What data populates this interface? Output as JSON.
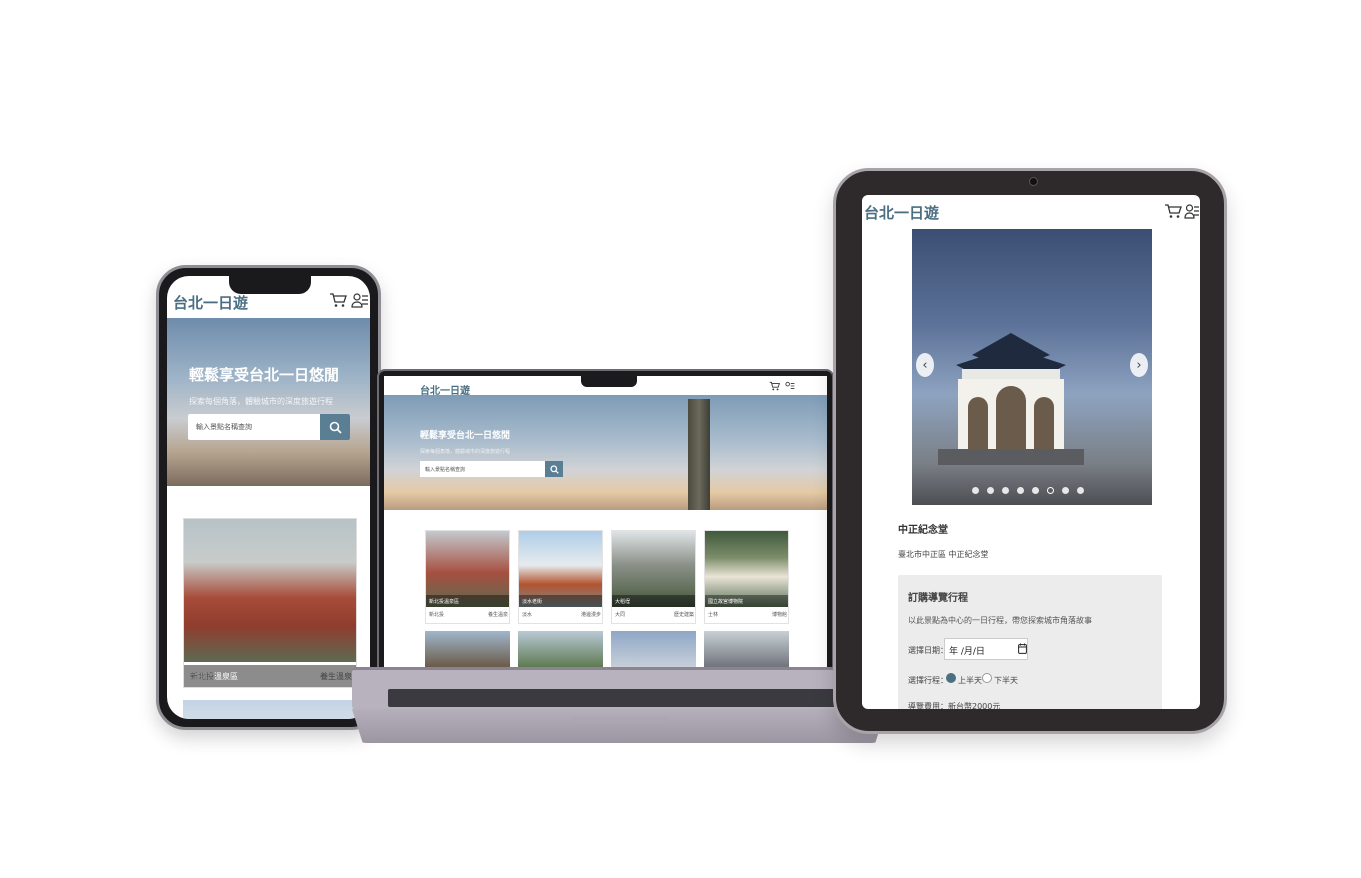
{
  "brand": {
    "name": "台北一日遊",
    "accent": "#4a6f82",
    "button": "#5a7f95"
  },
  "phone": {
    "hero_title": "輕鬆享受台北一日悠閒",
    "hero_subtitle": "探索每個角落，體驗城市的深度旅遊行程",
    "search_placeholder": "輸入景點名稱查詢",
    "card": {
      "caption": "新北投溫泉區",
      "area": "新北投",
      "tag": "養生溫泉"
    }
  },
  "laptop": {
    "hero_title": "輕鬆享受台北一日悠閒",
    "hero_subtitle": "探索每個角落，體驗城市的深度旅遊行程",
    "search_placeholder": "輸入景點名稱查詢",
    "cards": [
      {
        "caption": "新北投溫泉區",
        "area": "新北投",
        "tag": "養生溫泉"
      },
      {
        "caption": "淡水老街",
        "area": "淡水",
        "tag": "港邊漫步"
      },
      {
        "caption": "大稻埕",
        "area": "大同",
        "tag": "歷史建築"
      },
      {
        "caption": "國立故宮博物院",
        "area": "士林",
        "tag": "博物館"
      }
    ]
  },
  "tablet": {
    "attraction_title": "中正紀念堂",
    "address": "臺北市中正區 中正紀念堂",
    "booking": {
      "title": "訂購導覽行程",
      "description": "以此景點為中心的一日行程，帶您探索城市角落故事",
      "date_label": "選擇日期：",
      "date_value": "年 /月/日",
      "trip_label": "選擇行程：",
      "option_morning": "上半天",
      "option_afternoon": "下半天",
      "fee": "導覽費用：新台幣2000元"
    }
  }
}
